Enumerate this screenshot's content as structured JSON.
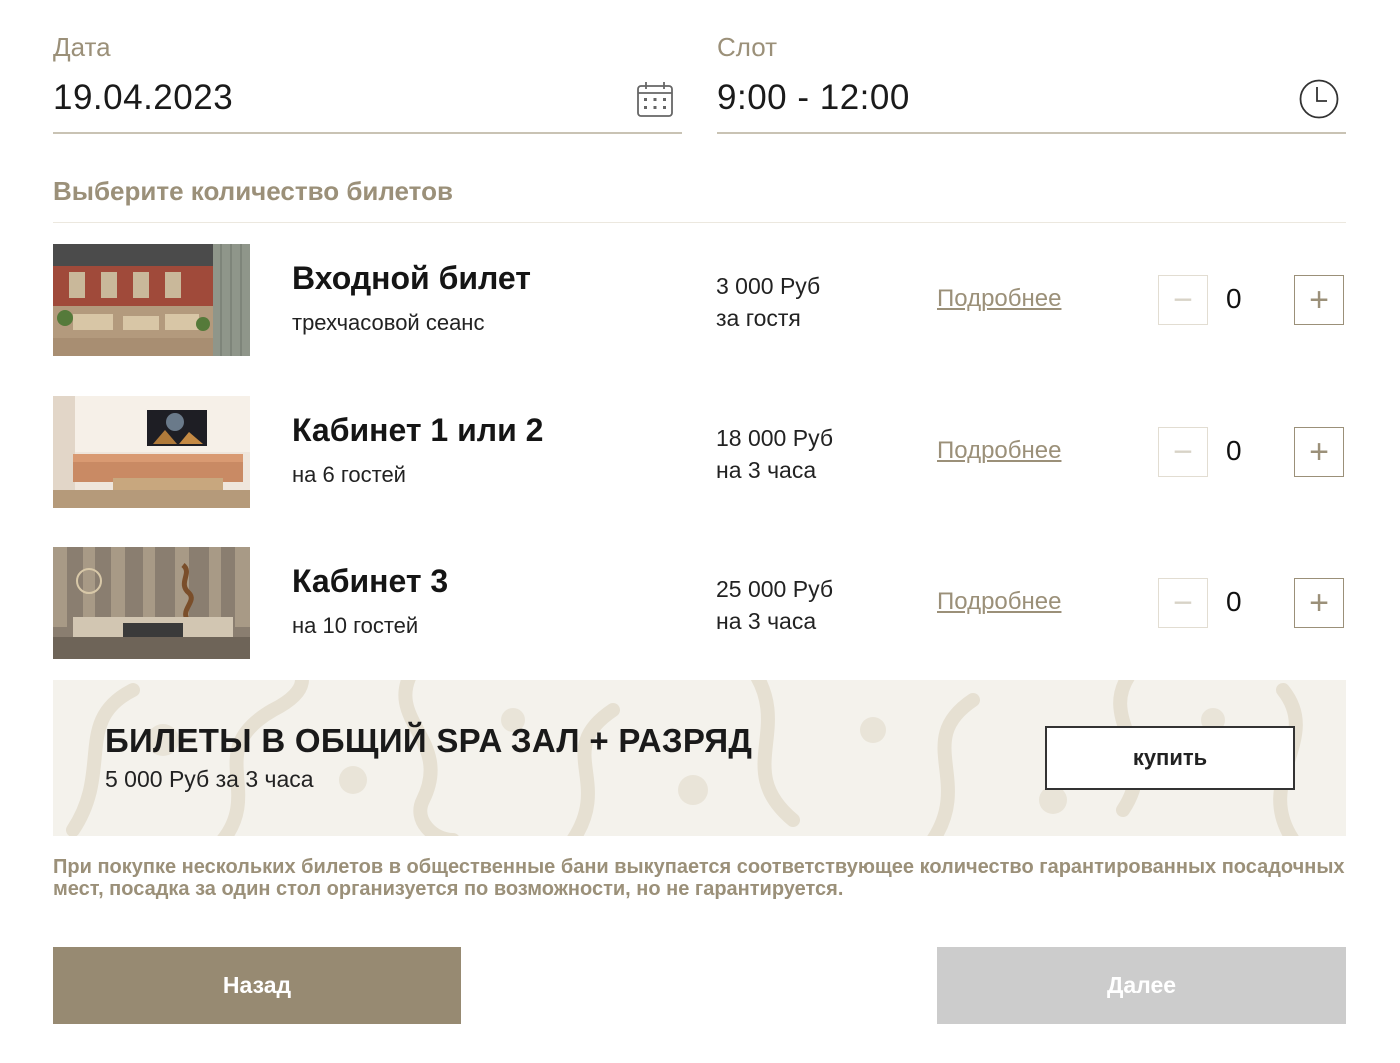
{
  "date_field": {
    "label": "Дата",
    "value": "19.04.2023",
    "icon": "calendar-icon"
  },
  "slot_field": {
    "label": "Слот",
    "value": "9:00 - 12:00",
    "icon": "clock-icon"
  },
  "section_title": "Выберите количество билетов",
  "tickets": [
    {
      "name": "Входной билет",
      "subtitle": "трехчасовой сеанс",
      "price": "3 000 Руб",
      "price_unit": "за гостя",
      "more": "Подробнее",
      "quantity": "0"
    },
    {
      "name": "Кабинет 1 или 2",
      "subtitle": "на 6 гостей",
      "price": "18 000 Руб",
      "price_unit": "на 3 часа",
      "more": "Подробнее",
      "quantity": "0"
    },
    {
      "name": "Кабинет 3",
      "subtitle": "на 10 гостей",
      "price": "25 000 Руб",
      "price_unit": "на 3 часа",
      "more": "Подробнее",
      "quantity": "0"
    }
  ],
  "promo": {
    "title": "БИЛЕТЫ В ОБЩИЙ SPA ЗАЛ + РАЗРЯД",
    "subtitle": "5 000 Руб за 3 часа",
    "button": "купить"
  },
  "note": "При покупке нескольких билетов в общественные бани выкупается соответствующее количество гарантированных посадочных мест, посадка за один стол организуется по возможности, но не гарантируется.",
  "buttons": {
    "back": "Назад",
    "next": "Далее"
  },
  "colors": {
    "accent": "#9b9079",
    "back_button": "#978a72",
    "next_button_disabled": "#cccccc"
  }
}
